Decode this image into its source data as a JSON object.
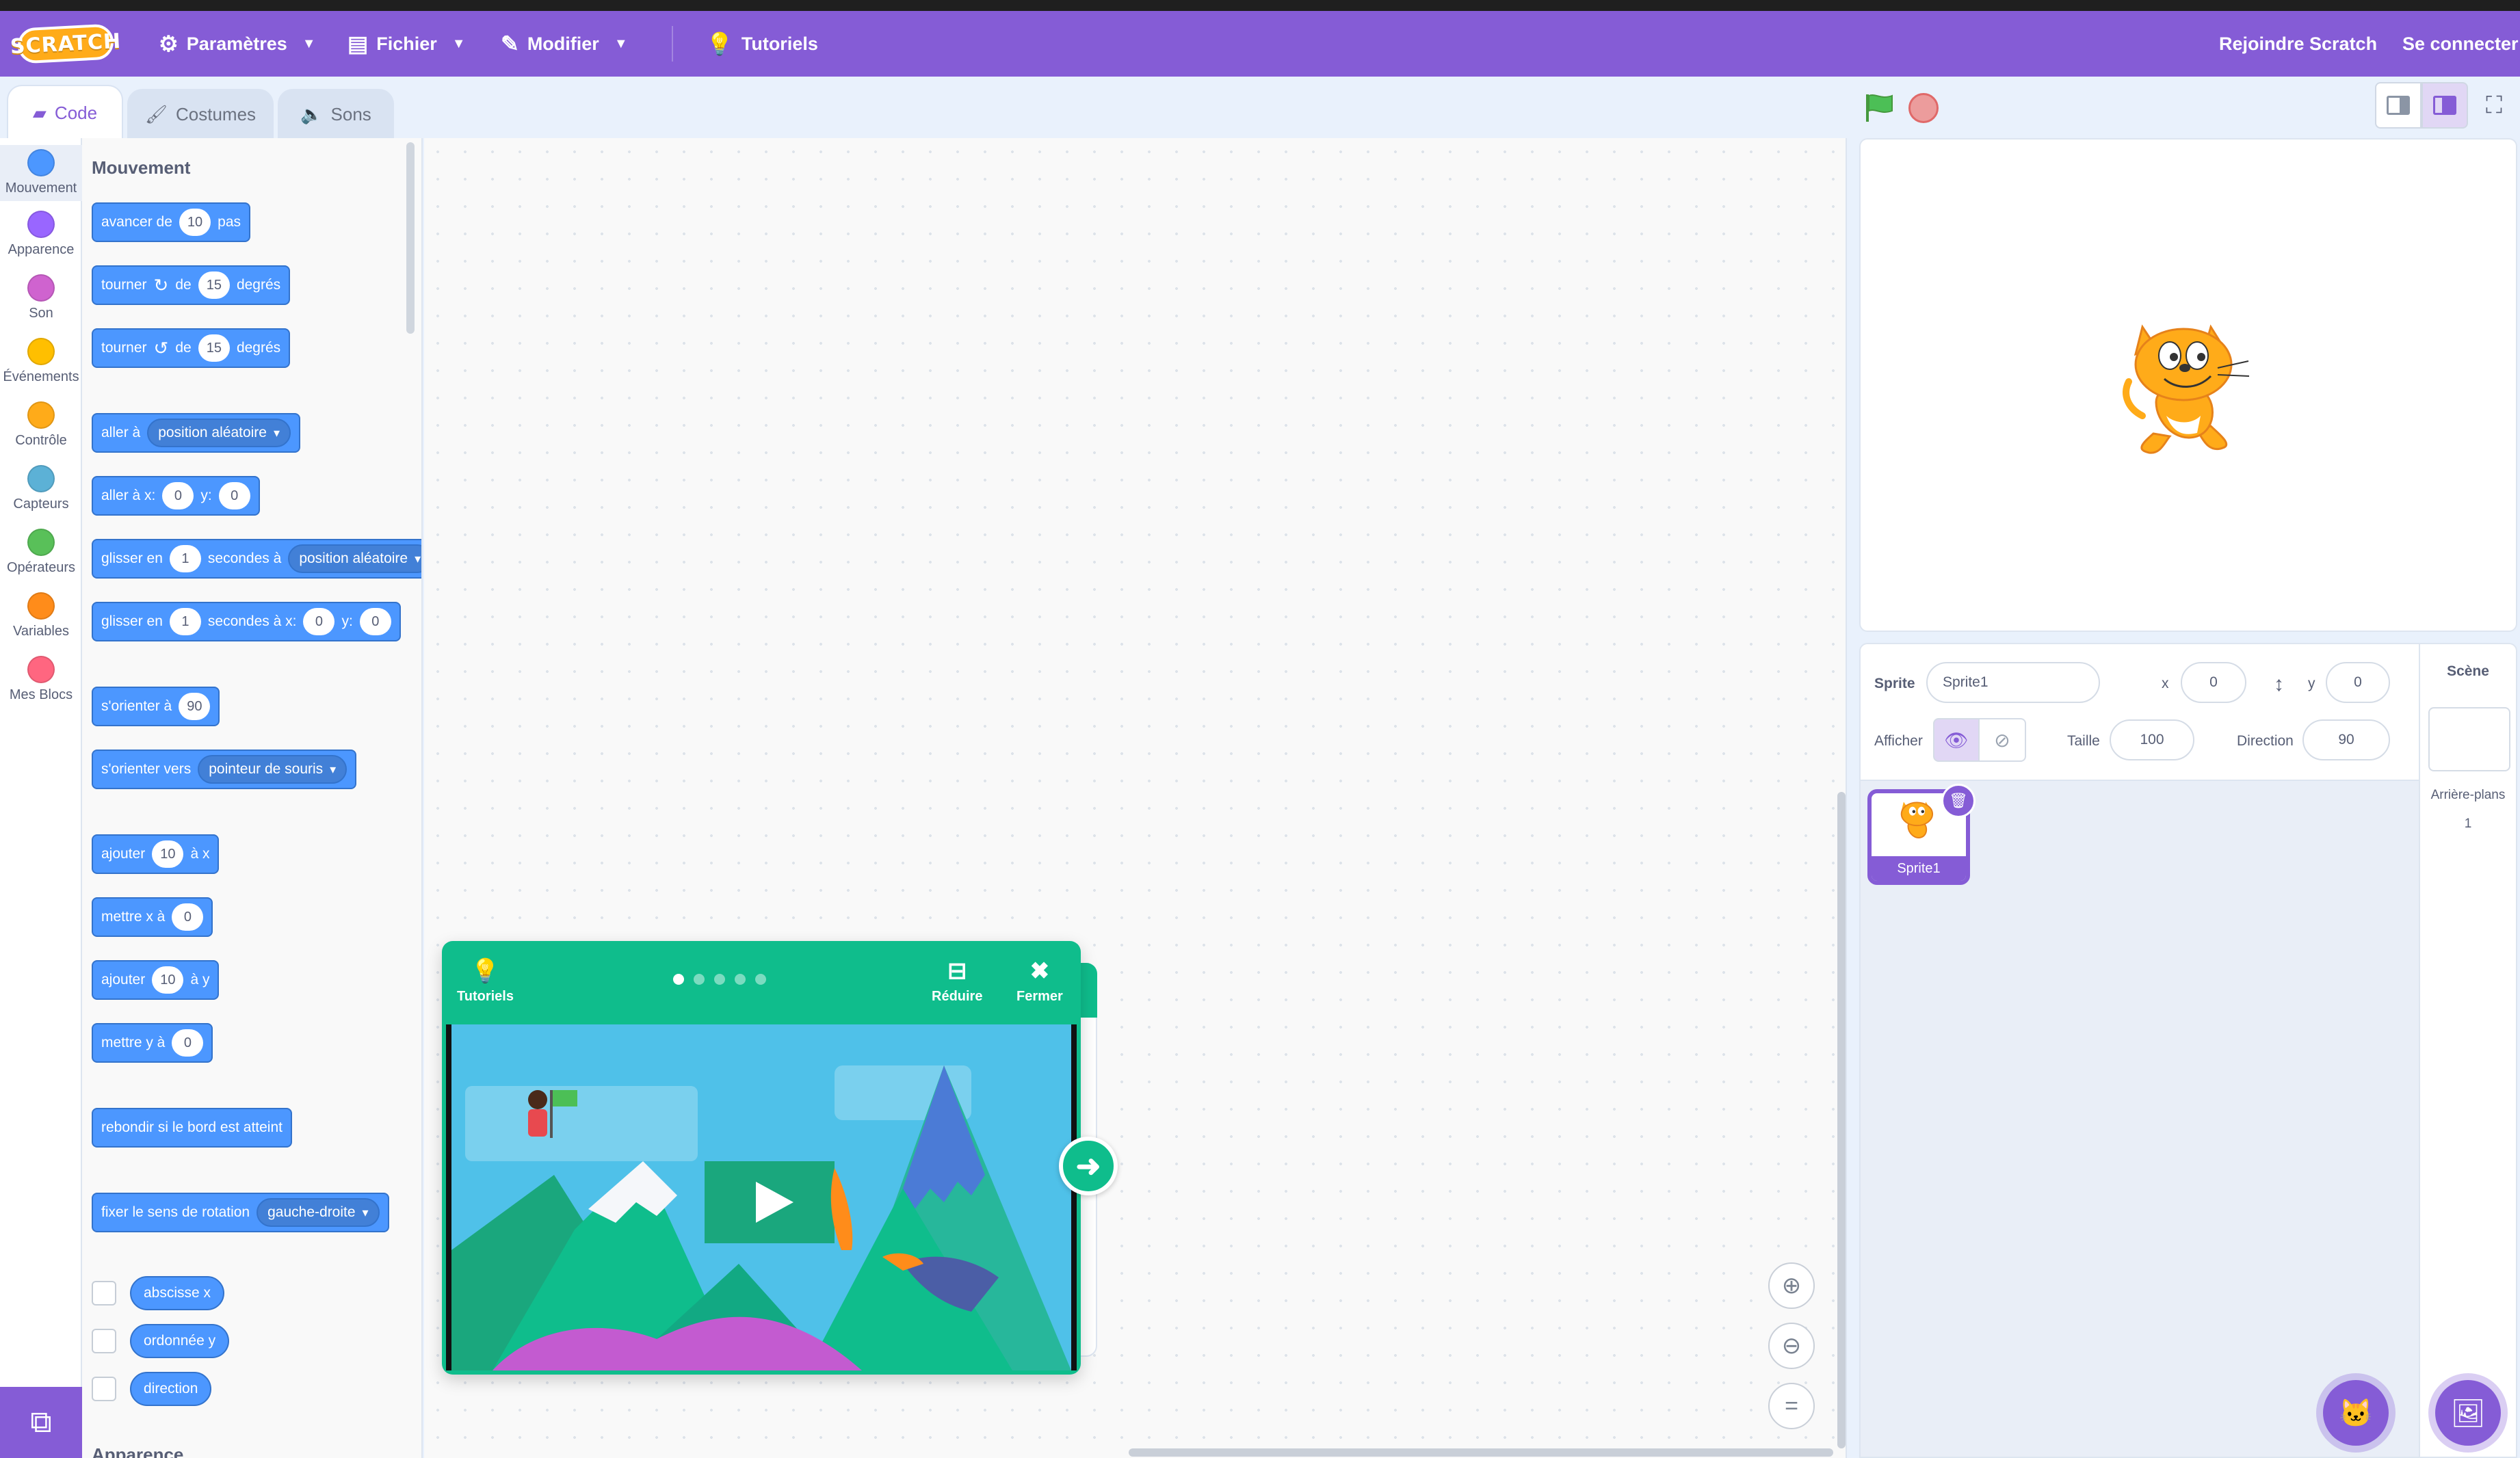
{
  "menubar": {
    "logo": "SCRATCH",
    "settings": "Paramètres",
    "file": "Fichier",
    "edit": "Modifier",
    "tutorials": "Tutoriels",
    "join": "Rejoindre Scratch",
    "signin": "Se connecter"
  },
  "tabs": {
    "code": "Code",
    "costumes": "Costumes",
    "sounds": "Sons"
  },
  "categories": [
    {
      "label": "Mouvement",
      "color": "#4c97ff"
    },
    {
      "label": "Apparence",
      "color": "#9966ff"
    },
    {
      "label": "Son",
      "color": "#cf63cf"
    },
    {
      "label": "Événements",
      "color": "#ffbf00"
    },
    {
      "label": "Contrôle",
      "color": "#ffab19"
    },
    {
      "label": "Capteurs",
      "color": "#5cb1d6"
    },
    {
      "label": "Opérateurs",
      "color": "#59c059"
    },
    {
      "label": "Variables",
      "color": "#ff8c1a"
    },
    {
      "label": "Mes Blocs",
      "color": "#ff6680"
    }
  ],
  "palette": {
    "heading": "Mouvement",
    "next_heading": "Apparence",
    "move": {
      "a": "avancer de",
      "v": "10",
      "b": "pas"
    },
    "turn_right": {
      "a": "tourner",
      "b": "de",
      "v": "15",
      "c": "degrés"
    },
    "turn_left": {
      "a": "tourner",
      "b": "de",
      "v": "15",
      "c": "degrés"
    },
    "goto": {
      "a": "aller à",
      "d": "position aléatoire"
    },
    "goto_xy": {
      "a": "aller à x:",
      "x": "0",
      "b": "y:",
      "y": "0"
    },
    "glide_to": {
      "a": "glisser en",
      "v": "1",
      "b": "secondes à",
      "d": "position aléatoire"
    },
    "glide_xy": {
      "a": "glisser en",
      "v": "1",
      "b": "secondes à x:",
      "x": "0",
      "c": "y:",
      "y": "0"
    },
    "point_dir": {
      "a": "s'orienter à",
      "v": "90"
    },
    "point_towards": {
      "a": "s'orienter vers",
      "d": "pointeur de souris"
    },
    "change_x": {
      "a": "ajouter",
      "v": "10",
      "b": "à x"
    },
    "set_x": {
      "a": "mettre x à",
      "v": "0"
    },
    "change_y": {
      "a": "ajouter",
      "v": "10",
      "b": "à y"
    },
    "set_y": {
      "a": "mettre y à",
      "v": "0"
    },
    "bounce": "rebondir si le bord est atteint",
    "rotation": {
      "a": "fixer le sens de rotation",
      "d": "gauche-droite"
    },
    "reporters": [
      "abscisse x",
      "ordonnée y",
      "direction"
    ]
  },
  "tutorial": {
    "title": "Tutoriels",
    "shrink": "Réduire",
    "close": "Fermer",
    "dots_total": 5,
    "dot_active": 1
  },
  "sprite_info": {
    "sprite_label": "Sprite",
    "sprite_name": "Sprite1",
    "x_label": "x",
    "x": "0",
    "y_label": "y",
    "y": "0",
    "show_label": "Afficher",
    "size_label": "Taille",
    "size": "100",
    "direction_label": "Direction",
    "direction": "90"
  },
  "sprites": [
    {
      "name": "Sprite1"
    }
  ],
  "stage_panel": {
    "title": "Scène",
    "backdrops_label": "Arrière-plans",
    "backdrops_count": "1"
  }
}
